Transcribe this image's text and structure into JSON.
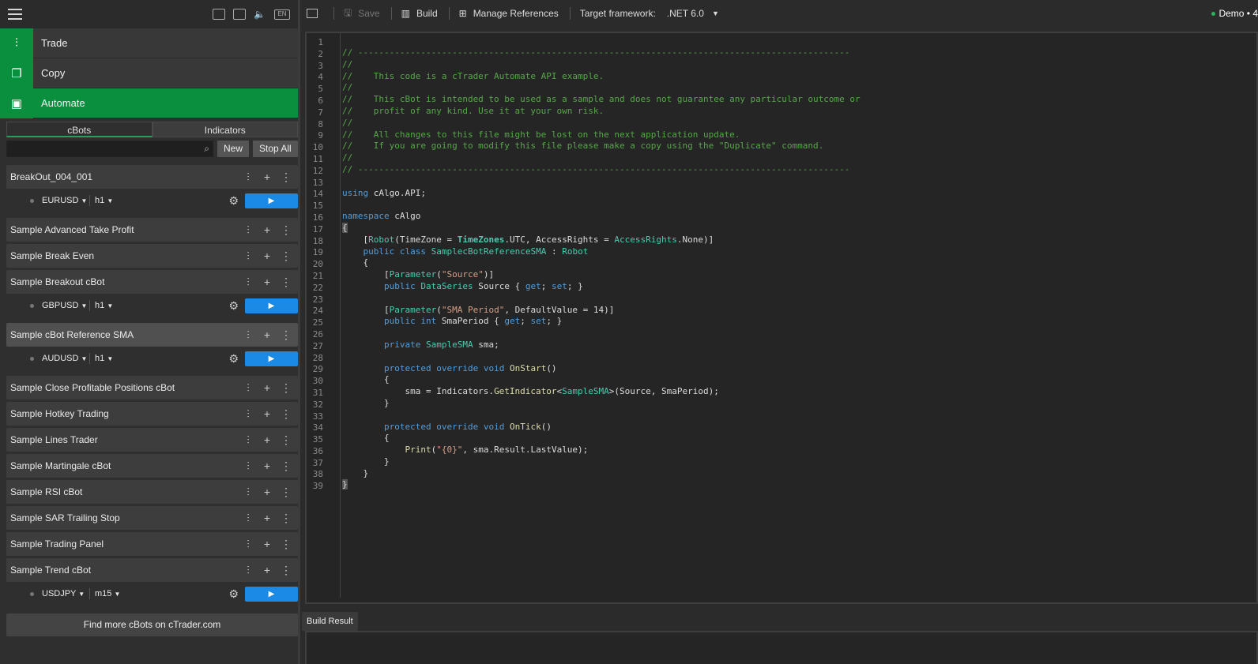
{
  "header": {
    "lang": "EN"
  },
  "nav": [
    {
      "label": "Trade",
      "icon": "candles-icon"
    },
    {
      "label": "Copy",
      "icon": "copy-icon"
    },
    {
      "label": "Automate",
      "icon": "robot-icon"
    }
  ],
  "tabs": {
    "cbots": "cBots",
    "indicators": "Indicators"
  },
  "search": {
    "placeholder": ""
  },
  "buttons": {
    "new": "New",
    "stop_all": "Stop All"
  },
  "bots": [
    {
      "name": "BreakOut_004_001",
      "instance": {
        "symbol": "EURUSD",
        "tf": "h1"
      }
    },
    {
      "name": "Sample Advanced Take Profit"
    },
    {
      "name": "Sample Break Even"
    },
    {
      "name": "Sample Breakout cBot",
      "instance": {
        "symbol": "GBPUSD",
        "tf": "h1"
      }
    },
    {
      "name": "Sample cBot Reference SMA",
      "selected": true,
      "instance": {
        "symbol": "AUDUSD",
        "tf": "h1"
      }
    },
    {
      "name": "Sample Close Profitable Positions cBot"
    },
    {
      "name": "Sample Hotkey Trading"
    },
    {
      "name": "Sample Lines Trader"
    },
    {
      "name": "Sample Martingale cBot"
    },
    {
      "name": "Sample RSI cBot"
    },
    {
      "name": "Sample SAR Trailing Stop"
    },
    {
      "name": "Sample Trading Panel"
    },
    {
      "name": "Sample Trend cBot",
      "instance": {
        "symbol": "USDJPY",
        "tf": "m15"
      }
    }
  ],
  "find_more": "Find more cBots on cTrader.com",
  "toolbar": {
    "save": "Save",
    "build": "Build",
    "manage": "Manage References",
    "target_label": "Target framework:",
    "target_value": ".NET 6.0",
    "account": "Demo • 4"
  },
  "editor": {
    "line_count": 39
  },
  "build_result": "Build Result"
}
